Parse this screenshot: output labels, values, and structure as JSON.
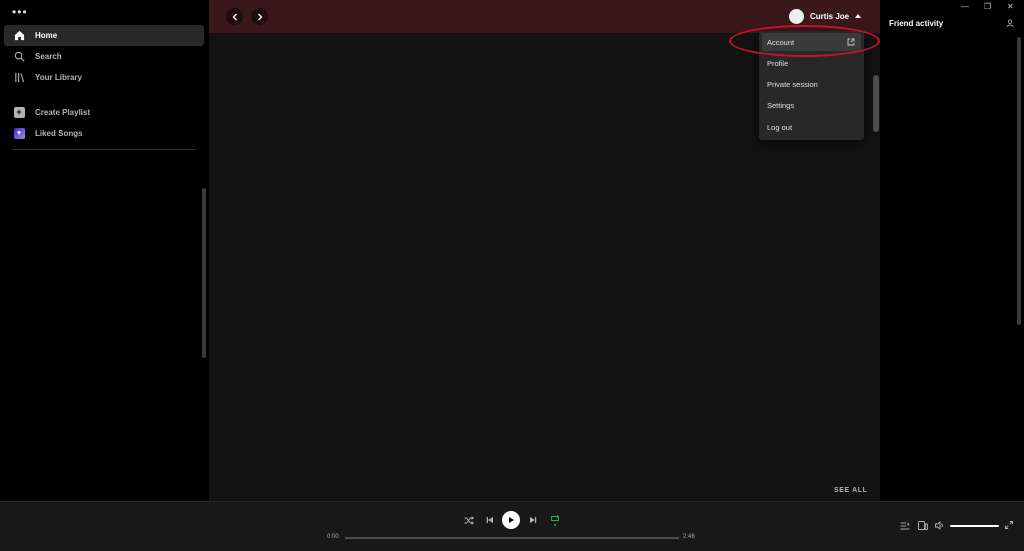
{
  "sidebar": {
    "menu_dots": "•••",
    "items": [
      {
        "label": "Home",
        "icon": "home-icon"
      },
      {
        "label": "Search",
        "icon": "search-icon"
      },
      {
        "label": "Your Library",
        "icon": "library-icon"
      },
      {
        "label": "Create Playlist",
        "icon": "plus-icon"
      },
      {
        "label": "Liked Songs",
        "icon": "heart-icon"
      }
    ]
  },
  "topbar": {
    "user_name": "Curtis Joe"
  },
  "user_menu": {
    "items": [
      {
        "label": "Account",
        "icon": "external-link-icon"
      },
      {
        "label": "Profile"
      },
      {
        "label": "Private session"
      },
      {
        "label": "Settings"
      },
      {
        "label": "Log out"
      }
    ],
    "highlight_color": "#c8102e"
  },
  "main": {
    "see_all": "SEE ALL"
  },
  "friend_activity": {
    "title": "Friend activity"
  },
  "window": {
    "minimize": "—",
    "restore": "❐",
    "close": "✕"
  },
  "player": {
    "elapsed": "0:00",
    "duration": "2:46",
    "progress_fraction": 0,
    "volume_fraction": 1,
    "accent_color": "#1db954"
  },
  "colors": {
    "topbar_bg": "#3a1719",
    "main_bg": "#121212",
    "menu_bg": "#282828"
  }
}
